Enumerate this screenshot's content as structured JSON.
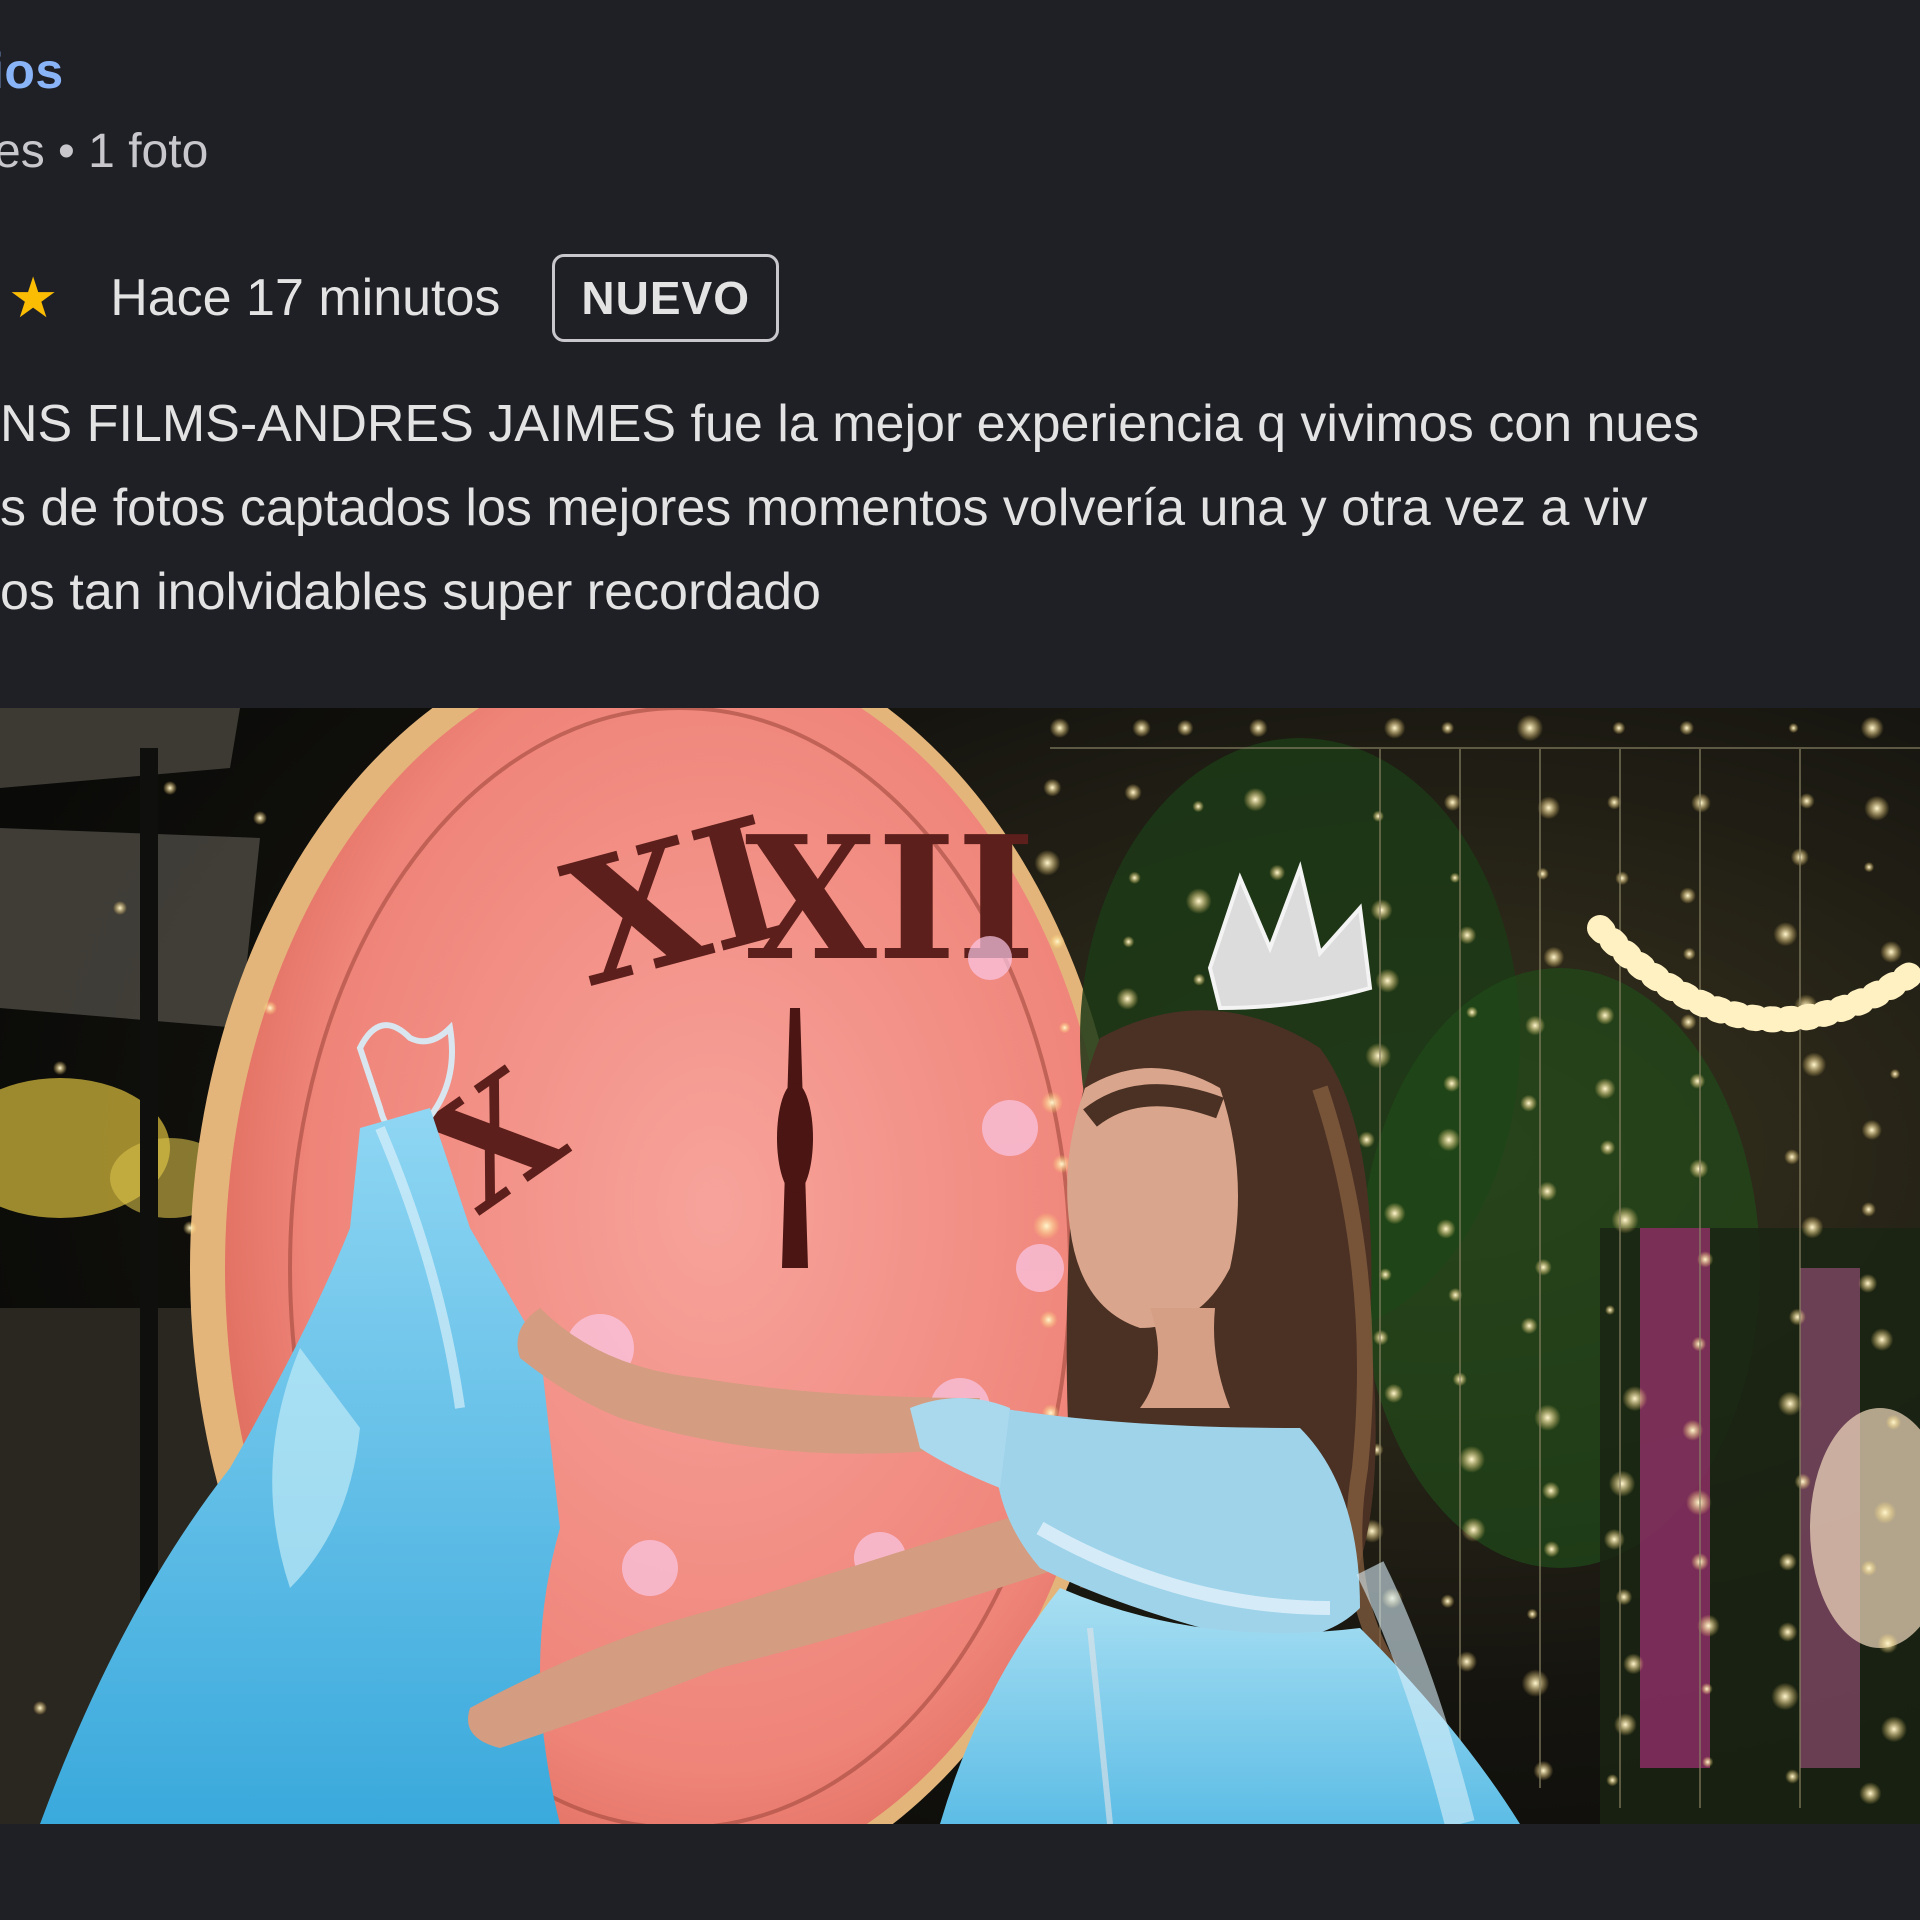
{
  "review": {
    "author_name": "ios",
    "author_meta": "es • 1 foto",
    "rating_icon": "star-icon",
    "time_ago": "Hace 17 minutos",
    "badge": "NUEVO",
    "text_lines": [
      "NS FILMS-ANDRES JAIMES fue la mejor experiencia q vivimos con nues",
      "s de fotos captados los mejores momentos volvería una y otra vez a viv",
      "os tan inolvidables super recordado"
    ],
    "photo_numerals": [
      "XI",
      "XII",
      "X"
    ]
  },
  "colors": {
    "background": "#1f2026",
    "author_link": "#8ab4f8",
    "star": "#fbbc04",
    "clock_face": "#f08a84",
    "dress": "#5fc3ea"
  }
}
